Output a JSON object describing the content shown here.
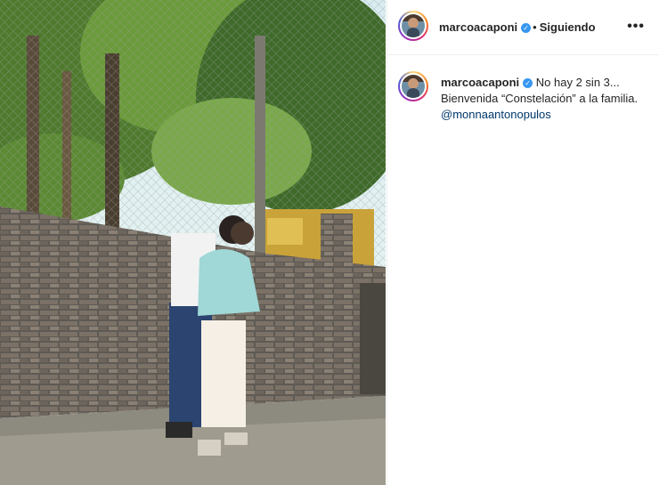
{
  "post": {
    "username": "marcoacaponi",
    "verified_icon": "verified-badge-icon",
    "separator": "•",
    "follow_status": "Siguiendo",
    "more_label": "•••",
    "caption": {
      "username": "marcoacaponi",
      "text_part1": "No hay 2 sin 3... Bienvenida “Constelación” a la familia.",
      "mention": "@monnaantonopulos"
    }
  },
  "colors": {
    "accent_link": "#00376b",
    "verified": "#3897f0",
    "text": "#262626"
  }
}
